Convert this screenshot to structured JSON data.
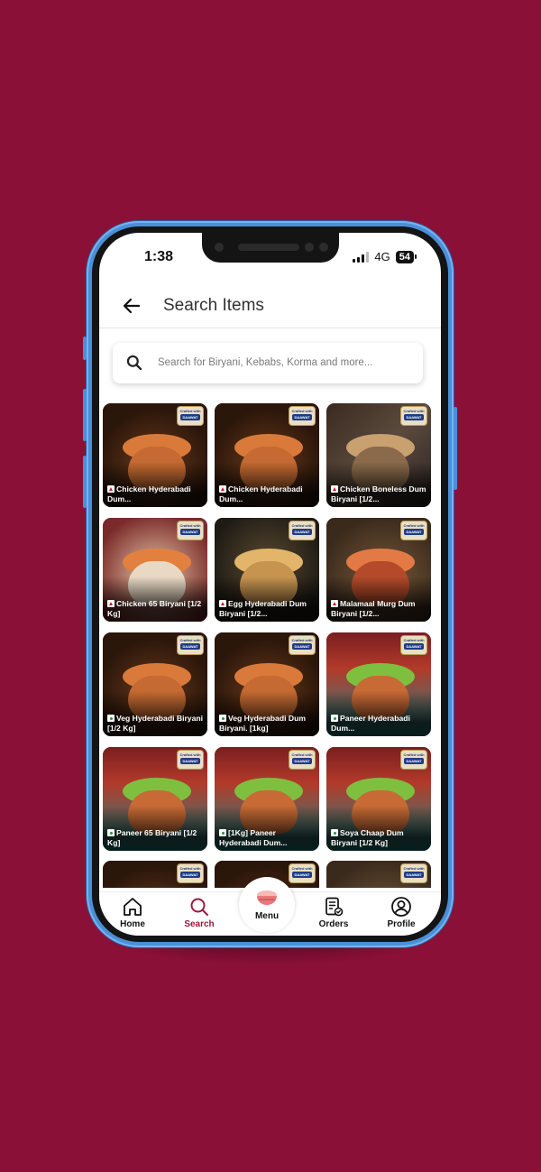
{
  "status_bar": {
    "time": "1:38",
    "network": "4G",
    "battery": "54"
  },
  "header": {
    "title": "Search Items"
  },
  "search": {
    "placeholder": "Search for Biryani, Kebabs, Korma and more..."
  },
  "badge": {
    "line1": "Crafted with",
    "line2": "DAAWAT"
  },
  "items": [
    {
      "name": "Chicken Hyderabadi Dum...",
      "type": "nonveg",
      "theme": "clay"
    },
    {
      "name": "Chicken Hyderabadi Dum...",
      "type": "nonveg",
      "theme": "clay"
    },
    {
      "name": "Chicken Boneless Dum Biryani [1/2...",
      "type": "nonveg",
      "theme": "box"
    },
    {
      "name": "Chicken 65 Biryani [1/2 Kg]",
      "type": "nonveg",
      "theme": "red"
    },
    {
      "name": "Egg Hyderabadi Dum Biryani [1/2...",
      "type": "nonveg",
      "theme": "bowl"
    },
    {
      "name": "Malamaal Murg Dum Biryani [1/2...",
      "type": "nonveg",
      "theme": "tray"
    },
    {
      "name": "Veg Hyderabadi Biryani [1/2 Kg]",
      "type": "veg",
      "theme": "clay"
    },
    {
      "name": "Veg Hyderabadi Dum Biryani. [1kg]",
      "type": "veg",
      "theme": "clay"
    },
    {
      "name": "Paneer Hyderabadi Dum...",
      "type": "veg",
      "theme": "green"
    },
    {
      "name": "Paneer 65 Biryani [1/2 Kg]",
      "type": "veg",
      "theme": "green"
    },
    {
      "name": "[1Kg] Paneer Hyderabadi Dum...",
      "type": "veg",
      "theme": "green"
    },
    {
      "name": "Soya Chaap Dum Biryani [1/2 Kg]",
      "type": "veg",
      "theme": "green"
    },
    {
      "name": "",
      "type": "",
      "theme": "clay"
    },
    {
      "name": "",
      "type": "",
      "theme": "clay"
    },
    {
      "name": "",
      "type": "",
      "theme": "tray"
    }
  ],
  "nav": {
    "home": "Home",
    "search": "Search",
    "menu": "Menu",
    "orders": "Orders",
    "profile": "Profile"
  },
  "colors": {
    "background": "#8a1038",
    "accent": "#a0143c",
    "phone_frame": "#4a8fd8"
  }
}
